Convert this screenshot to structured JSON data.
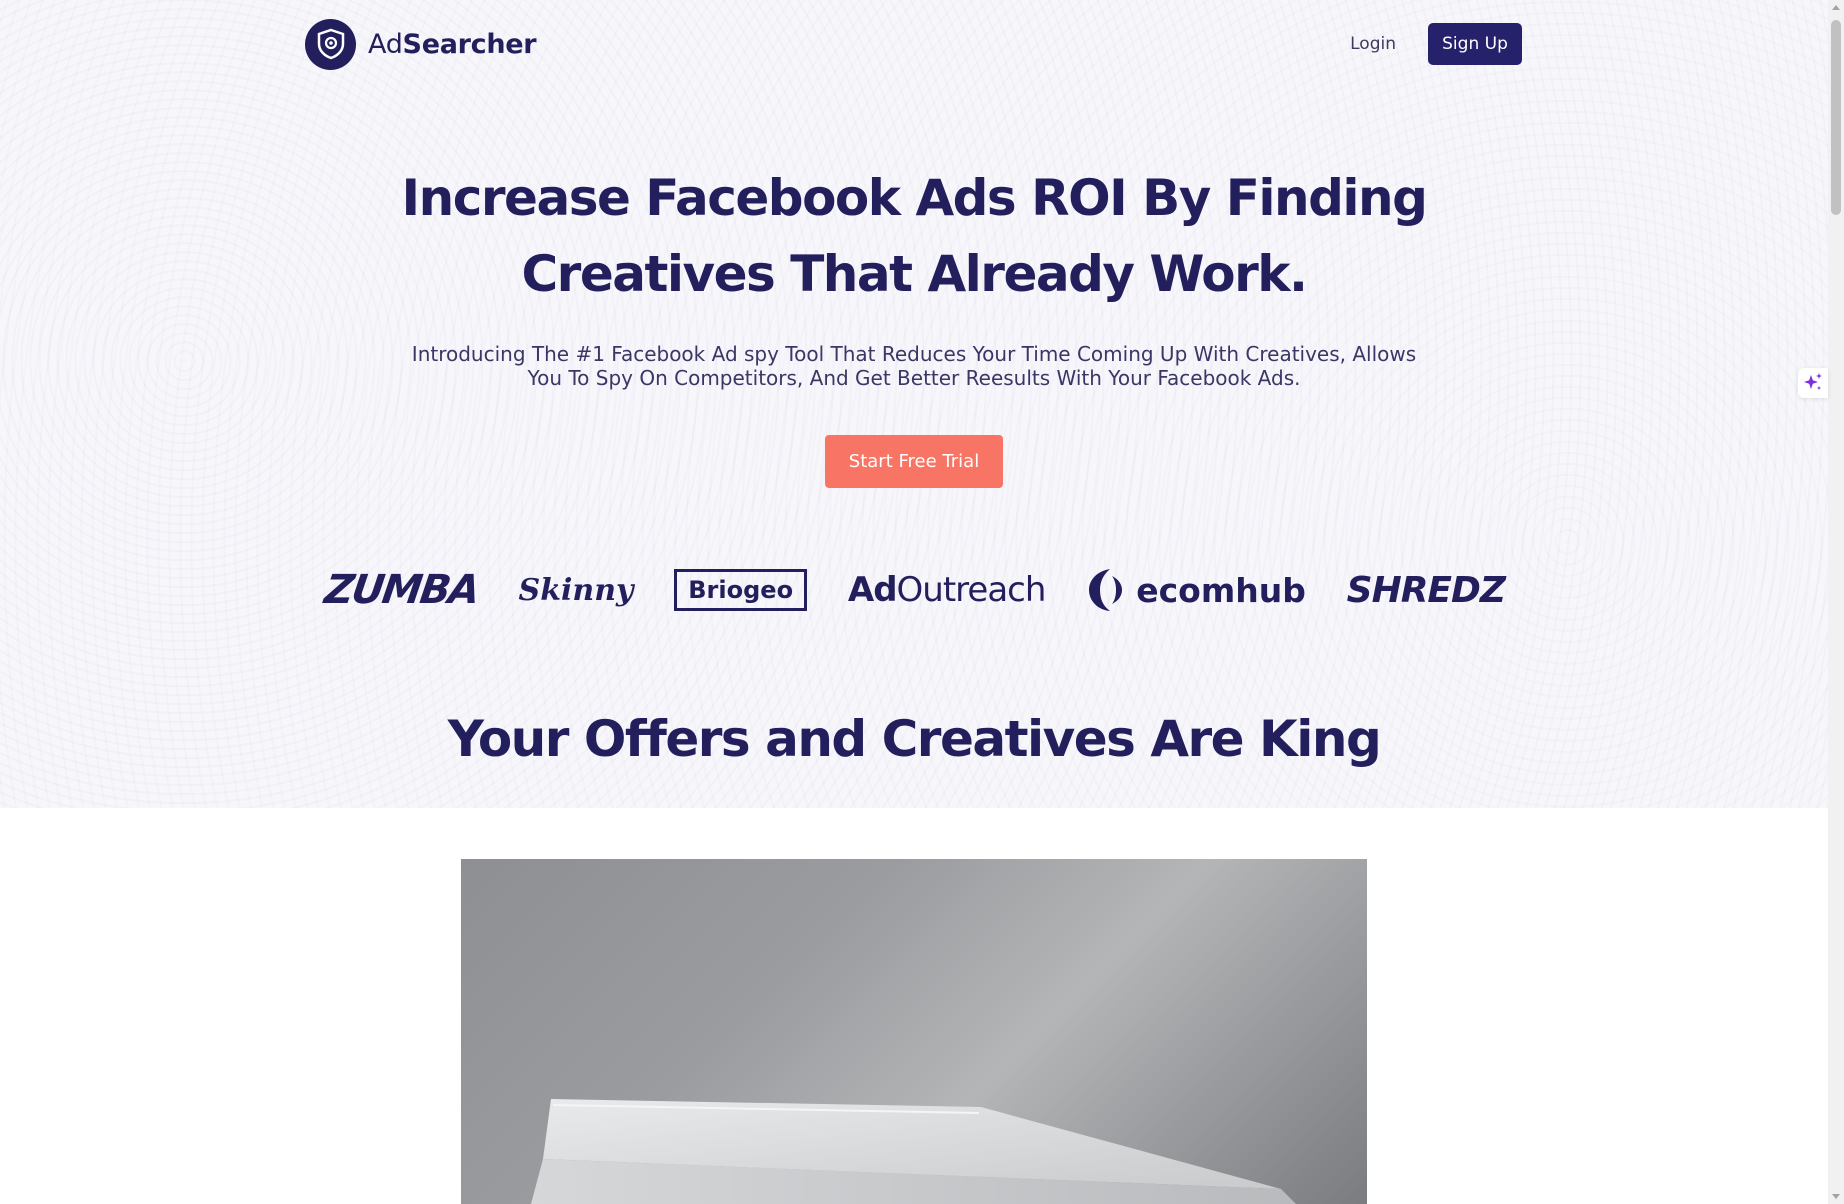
{
  "header": {
    "brand_prefix": "Ad",
    "brand_suffix": "Searcher",
    "login_label": "Login",
    "signup_label": "Sign Up"
  },
  "hero": {
    "title_line1": "Increase Facebook Ads ROI By Finding",
    "title_line2": "Creatives That Already Work.",
    "subtitle_line1": "Introducing The #1 Facebook Ad spy Tool That Reduces Your Time Coming Up With Creatives, Allows",
    "subtitle_line2": "You To Spy On Competitors, And Get Better Reesults With Your Facebook Ads.",
    "cta_label": "Start Free Trial"
  },
  "logos": {
    "zumba": "ZUMBA",
    "skinny_bunny": "Skinny",
    "briogeo": "Briogeo",
    "adoutreach_ad": "Ad",
    "adoutreach_rest": "Outreach",
    "ecomhub": "ecomhub",
    "shredz": "SHREDZ"
  },
  "section": {
    "title": "Your Offers and Creatives Are King"
  },
  "icons": {
    "brand_logo": "shield-icon",
    "widget": "sparkle-icon",
    "ecomhub_mark": "crescent-icon"
  },
  "colors": {
    "primary": "#231f5c",
    "signup_bg": "#25226b",
    "cta_bg": "#f87565",
    "page_bg": "#f7f6fb"
  }
}
